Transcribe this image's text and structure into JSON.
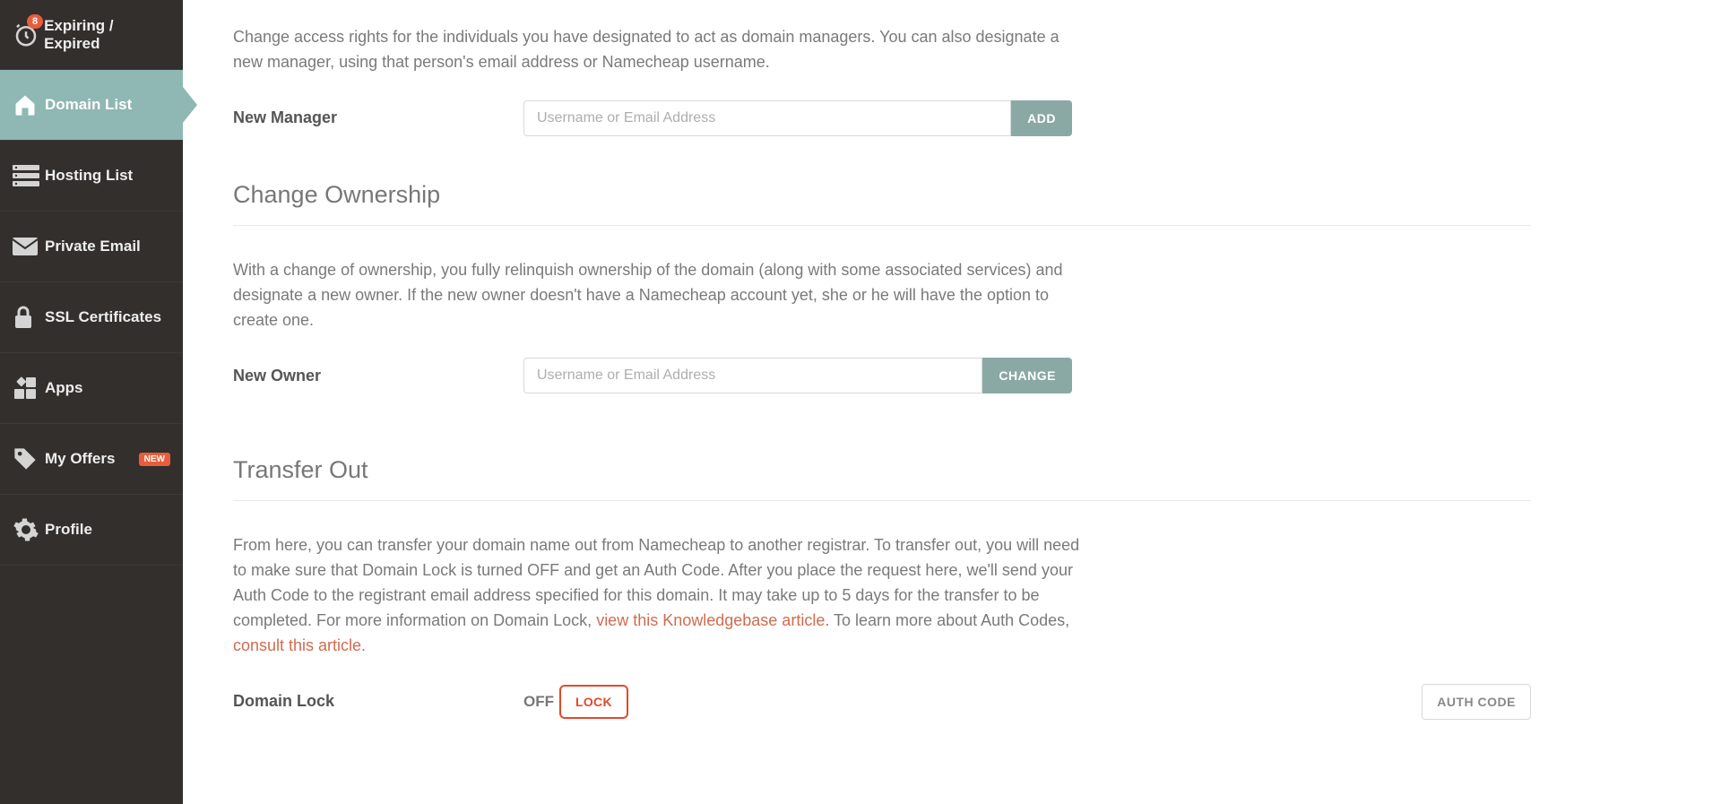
{
  "sidebar": {
    "badge_count": "8",
    "items": [
      {
        "label": "Expiring / Expired"
      },
      {
        "label": "Domain List"
      },
      {
        "label": "Hosting List"
      },
      {
        "label": "Private Email"
      },
      {
        "label": "SSL Certificates"
      },
      {
        "label": "Apps"
      },
      {
        "label": "My Offers",
        "tag": "NEW"
      },
      {
        "label": "Profile"
      }
    ]
  },
  "manager": {
    "intro": "Change access rights for the individuals you have designated to act as domain managers. You can also designate a new manager, using that person's email address or Namecheap username.",
    "label": "New Manager",
    "placeholder": "Username or Email Address",
    "button": "ADD"
  },
  "ownership": {
    "heading": "Change Ownership",
    "intro": "With a change of ownership, you fully relinquish ownership of the domain (along with some associated services) and designate a new owner. If the new owner doesn't have a Namecheap account yet, she or he will have the option to create one.",
    "label": "New Owner",
    "placeholder": "Username or Email Address",
    "button": "CHANGE"
  },
  "transfer": {
    "heading": "Transfer Out",
    "intro_a": "From here, you can transfer your domain name out from Namecheap to another registrar. To transfer out, you will need to make sure that Domain Lock is turned OFF and get an Auth Code. After you place the request here, we'll send your Auth Code to the registrant email address specified for this domain. It may take up to 5 days for the transfer to be completed. For more information on Domain Lock, ",
    "link_a": "view this Knowledgebase article.",
    "intro_b": " To learn more about Auth Codes, ",
    "link_b": "consult this article.",
    "lock_label": "Domain Lock",
    "lock_status": "OFF",
    "lock_button": "LOCK",
    "auth_button": "AUTH CODE"
  }
}
